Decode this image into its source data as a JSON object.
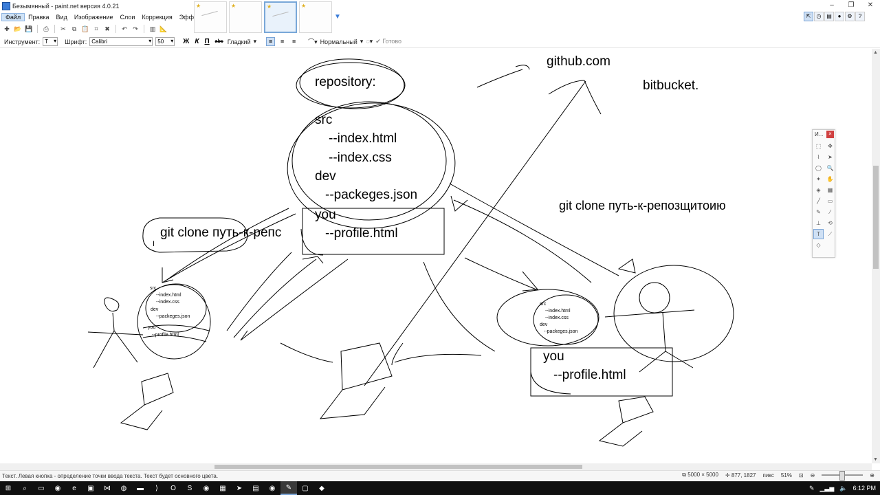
{
  "window": {
    "title": "Безымянный - paint.net версия 4.0.21"
  },
  "menu": [
    "Файл",
    "Правка",
    "Вид",
    "Изображение",
    "Слои",
    "Коррекция",
    "Эффекты"
  ],
  "toolbar2": {
    "tool_label": "Инструмент:",
    "tool_value": "T",
    "font_label": "Шрифт:",
    "font_value": "Calibri",
    "size_value": "50",
    "bold": "Ж",
    "italic": "К",
    "underline": "П",
    "strike": "abc",
    "smoothing": "Гладкий",
    "blend_mode": "Нормальный",
    "finish": "Готово"
  },
  "canvas_text": {
    "github": "github.com",
    "bitbucket": "bitbucket.",
    "repository": "repository:",
    "src": "src",
    "index_html": "--index.html",
    "index_css": "--index.css",
    "dev": "dev",
    "packeges": "--packeges.json",
    "you": "you",
    "profile": "--profile.html",
    "git_clone_left": "git clone путь-к-репс",
    "git_clone_right": "git clone путь-к-репозщитоию",
    "small_left": {
      "src": "src",
      "index_html": "--index.html",
      "index_css": "--index.css",
      "dev": "dev",
      "packeges": "--packeges.json",
      "you": "you",
      "profile": "--profile.html"
    },
    "small_right": {
      "src": "src",
      "index_html": "--index.html",
      "index_css": "--index.css",
      "dev": "dev",
      "packeges": "--packeges.json"
    },
    "right_you": "you",
    "right_profile": "--profile.html"
  },
  "tools_window": {
    "title": "И..."
  },
  "status": {
    "hint": "Текст. Левая кнопка - определение точки ввода текста. Текст будет основного цвета.",
    "image_size": "5000 × 5000",
    "cursor_pos": "877, 1827",
    "units": "пикс",
    "zoom": "51%"
  },
  "taskbar": {
    "time": "6:12 PM"
  }
}
